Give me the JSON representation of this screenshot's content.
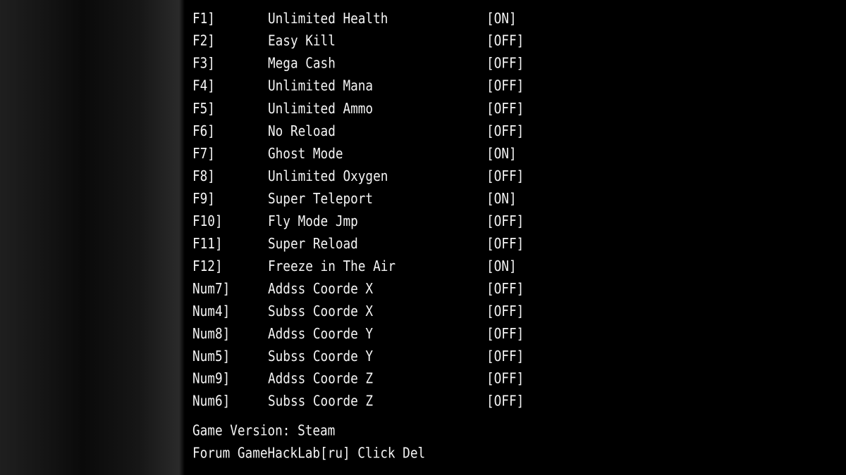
{
  "hotkeys": [
    {
      "key": "F1]",
      "name": "Unlimited Health",
      "state": "[ON]"
    },
    {
      "key": "F2]",
      "name": "Easy Kill",
      "state": "[OFF]"
    },
    {
      "key": "F3]",
      "name": "Mega Cash",
      "state": "[OFF]"
    },
    {
      "key": "F4]",
      "name": "Unlimited Mana",
      "state": "[OFF]"
    },
    {
      "key": "F5]",
      "name": "Unlimited Ammo",
      "state": "[OFF]"
    },
    {
      "key": "F6]",
      "name": "No Reload",
      "state": "[OFF]"
    },
    {
      "key": "F7]",
      "name": "Ghost Mode",
      "state": "[ON]"
    },
    {
      "key": "F8]",
      "name": "Unlimited Oxygen",
      "state": "[OFF]"
    },
    {
      "key": "F9]",
      "name": "Super Teleport",
      "state": "[ON]"
    },
    {
      "key": "F10]",
      "name": "Fly Mode Jmp",
      "state": "[OFF]"
    },
    {
      "key": "F11]",
      "name": "Super Reload",
      "state": "[OFF]"
    },
    {
      "key": "F12]",
      "name": "Freeze in The Air",
      "state": "[ON]"
    },
    {
      "key": "Num7]",
      "name": "Addss Coorde X",
      "state": "[OFF]"
    },
    {
      "key": "Num4]",
      "name": "Subss Coorde X",
      "state": "[OFF]"
    },
    {
      "key": "Num8]",
      "name": "Addss Coorde Y",
      "state": "[OFF]"
    },
    {
      "key": "Num5]",
      "name": "Subss Coorde Y",
      "state": "[OFF]"
    },
    {
      "key": "Num9]",
      "name": "Addss Coorde Z",
      "state": "[OFF]"
    },
    {
      "key": "Num6]",
      "name": "Subss Coorde Z",
      "state": "[OFF]"
    }
  ],
  "footer": {
    "version": "Game Version: Steam",
    "forum": "Forum GameHackLab[ru] Click Del"
  },
  "colors": {
    "text": "#f4f4f4",
    "background": "#000000"
  }
}
